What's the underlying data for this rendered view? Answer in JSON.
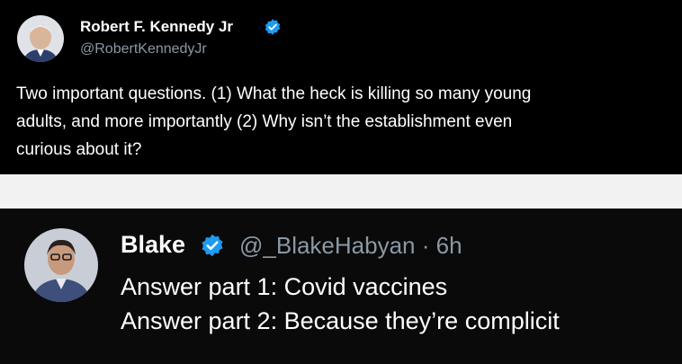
{
  "tweet": {
    "author_name": "Robert F. Kennedy Jr",
    "author_handle": "@RobertKennedyJr",
    "verified_icon": "verified-badge-icon",
    "text_lines": [
      "Two important questions. (1) What the heck is killing so many young",
      "adults, and more importantly (2) Why isn’t the establishment even",
      "curious about it?"
    ]
  },
  "reply": {
    "author_name": "Blake",
    "author_handle": "@_BlakeHabyan · 6h",
    "verified_icon": "verified-badge-icon",
    "text_lines": [
      "Answer part 1: Covid vaccines",
      "Answer part 2: Because they’re complicit"
    ]
  },
  "colors": {
    "verified_blue": "#1d9bf0",
    "handle_gray": "#8b98a5",
    "background_dark": "#000000"
  }
}
